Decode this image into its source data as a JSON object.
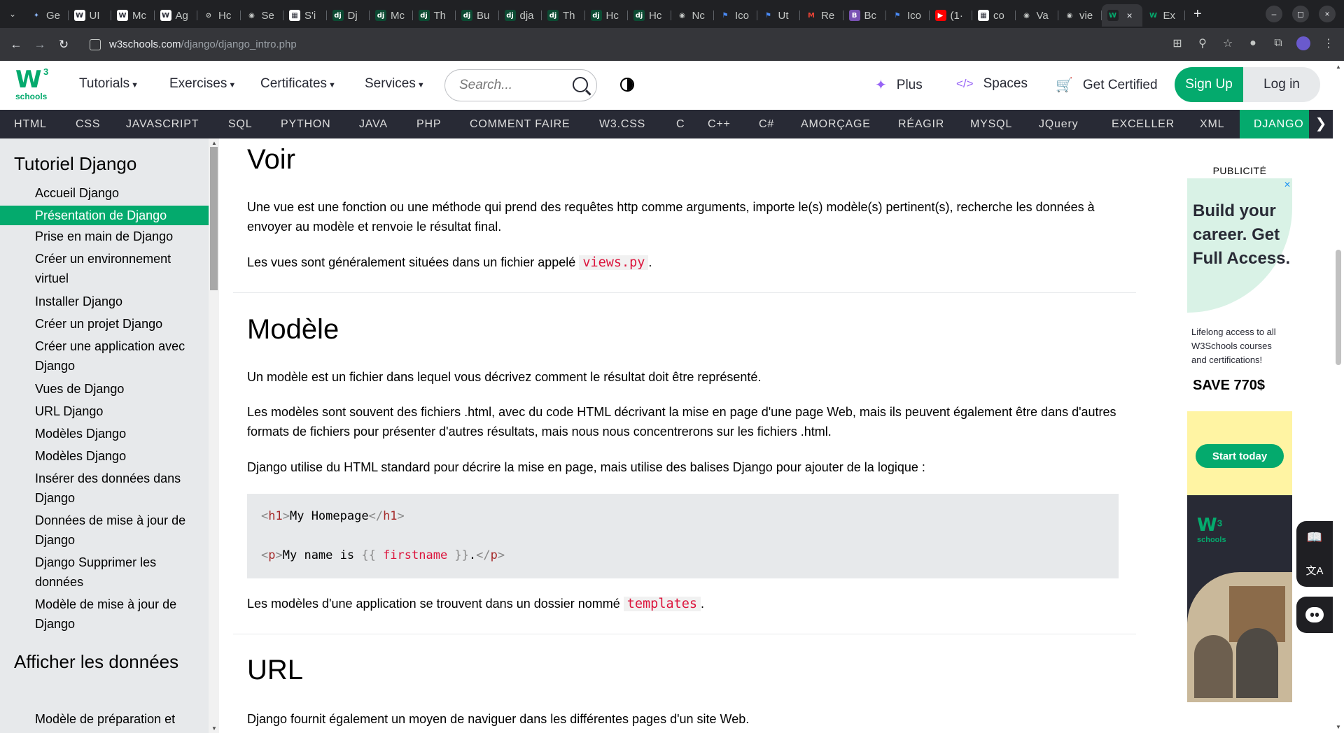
{
  "browser": {
    "tabs": [
      {
        "label": "Ge",
        "icon": "✦",
        "icon_bg": "#202124",
        "icon_fg": "#8ab4f8"
      },
      {
        "label": "UI",
        "icon": "W",
        "icon_bg": "#ffffff",
        "icon_fg": "#282a35"
      },
      {
        "label": "Mc",
        "icon": "W",
        "icon_bg": "#ffffff",
        "icon_fg": "#282a35"
      },
      {
        "label": "Ag",
        "icon": "W",
        "icon_bg": "#ffffff",
        "icon_fg": "#282a35"
      },
      {
        "label": "Hc",
        "icon": "⊘",
        "icon_bg": "#202124",
        "icon_fg": "#c4c7c5"
      },
      {
        "label": "Se",
        "icon": "◉",
        "icon_bg": "#202124",
        "icon_fg": "#c4c7c5"
      },
      {
        "label": "S'i",
        "icon": "▦",
        "icon_bg": "#ffffff",
        "icon_fg": "#282a35"
      },
      {
        "label": "Dj",
        "icon": "dj",
        "icon_bg": "#0c4b33",
        "icon_fg": "#ffffff"
      },
      {
        "label": "Mc",
        "icon": "dj",
        "icon_bg": "#0c4b33",
        "icon_fg": "#ffffff"
      },
      {
        "label": "Th",
        "icon": "dj",
        "icon_bg": "#0c4b33",
        "icon_fg": "#ffffff"
      },
      {
        "label": "Bu",
        "icon": "dj",
        "icon_bg": "#0c4b33",
        "icon_fg": "#ffffff"
      },
      {
        "label": "dja",
        "icon": "dj",
        "icon_bg": "#0c4b33",
        "icon_fg": "#ffffff"
      },
      {
        "label": "Th",
        "icon": "dj",
        "icon_bg": "#0c4b33",
        "icon_fg": "#ffffff"
      },
      {
        "label": "Hc",
        "icon": "dj",
        "icon_bg": "#0c4b33",
        "icon_fg": "#ffffff"
      },
      {
        "label": "Hc",
        "icon": "dj",
        "icon_bg": "#0c4b33",
        "icon_fg": "#ffffff"
      },
      {
        "label": "Nc",
        "icon": "◉",
        "icon_bg": "#202124",
        "icon_fg": "#c4c7c5"
      },
      {
        "label": "Ico",
        "icon": "⚑",
        "icon_bg": "#202124",
        "icon_fg": "#4a8af4"
      },
      {
        "label": "Ut",
        "icon": "⚑",
        "icon_bg": "#202124",
        "icon_fg": "#4a8af4"
      },
      {
        "label": "Re",
        "icon": "M",
        "icon_bg": "#202124",
        "icon_fg": "#ea4335"
      },
      {
        "label": "Bc",
        "icon": "B",
        "icon_bg": "#7952b3",
        "icon_fg": "#ffffff"
      },
      {
        "label": "Ico",
        "icon": "⚑",
        "icon_bg": "#202124",
        "icon_fg": "#4a8af4"
      },
      {
        "label": "(1·",
        "icon": "▶",
        "icon_bg": "#ff0000",
        "icon_fg": "#ffffff"
      },
      {
        "label": "co",
        "icon": "▦",
        "icon_bg": "#ffffff",
        "icon_fg": "#282a35"
      },
      {
        "label": "Va",
        "icon": "◉",
        "icon_bg": "#202124",
        "icon_fg": "#c4c7c5"
      },
      {
        "label": "vie",
        "icon": "◉",
        "icon_bg": "#202124",
        "icon_fg": "#c4c7c5"
      }
    ],
    "active_tab": {
      "label": "",
      "icon": "W",
      "icon_bg": "#202124",
      "icon_fg": "#04aa6d",
      "close": "×"
    },
    "last_tab": {
      "label": "Ex",
      "icon": "W",
      "icon_bg": "#202124",
      "icon_fg": "#04aa6d"
    },
    "new_tab": "+",
    "window_controls": [
      "–",
      "◻",
      "×"
    ],
    "url_host": "w3schools.com",
    "url_path": "/django/django_intro.php"
  },
  "topnav": {
    "logo_mark": "W",
    "logo_sup": "3",
    "logo_text": "schools",
    "menus": [
      {
        "label": "Tutorials",
        "caret": "▼"
      },
      {
        "label": "Exercises",
        "caret": "▼"
      },
      {
        "label": "Certificates",
        "caret": "▼"
      },
      {
        "label": "Services",
        "caret": "▼"
      }
    ],
    "search_placeholder": "Search...",
    "plus": "Plus",
    "spaces": "Spaces",
    "get_certified": "Get Certified",
    "sign_up": "Sign Up",
    "log_in": "Log in"
  },
  "subnav": {
    "items": [
      "HTML",
      "CSS",
      "JAVASCRIPT",
      "SQL",
      "PYTHON",
      "JAVA",
      "PHP",
      "COMMENT FAIRE",
      "W3.CSS",
      "C",
      "C++",
      "C#",
      "AMORÇAGE",
      "RÉAGIR",
      "MYSQL",
      "JQuery",
      "EXCELLER",
      "XML",
      "DJANGO"
    ],
    "arrow": "❯"
  },
  "sidebar": {
    "title1": "Tutoriel Django",
    "items": [
      "Accueil Django",
      "Présentation de Django",
      "Prise en main de Django",
      "Créer un environnement virtuel",
      "Installer Django",
      "Créer un projet Django",
      "Créer une application avec Django",
      "Vues de Django",
      "URL Django",
      "Modèles Django",
      "Modèles Django",
      "Insérer des données dans Django",
      "Données de mise à jour de Django",
      "Django Supprimer les données",
      "Modèle de mise à jour de Django"
    ],
    "title2": "Afficher les données",
    "item_after": "Modèle de préparation et"
  },
  "content": {
    "h_voir": "Voir",
    "p_voir1": "Une vue est une fonction ou une méthode qui prend des requêtes http comme arguments, importe le(s) modèle(s) pertinent(s), recherche les données à envoyer au modèle et renvoie le résultat final.",
    "p_voir2_before": "Les vues sont généralement situées dans un fichier appelé ",
    "p_voir2_code": "views.py",
    "p_voir2_after": ".",
    "h_modele": "Modèle",
    "p_mod1": "Un modèle est un fichier dans lequel vous décrivez comment le résultat doit être représenté.",
    "p_mod2": "Les modèles sont souvent des fichiers .html, avec du code HTML décrivant la mise en page d'une page Web, mais ils peuvent également être dans d'autres formats de fichiers pour présenter d'autres résultats, mais nous nous concentrerons sur les fichiers .html.",
    "p_mod3": "Django utilise du HTML standard pour décrire la mise en page, mais utilise des balises Django pour ajouter de la logique :",
    "code": {
      "l1_lt": "<",
      "l1_tag": "h1",
      "l1_gt": ">",
      "l1_text": "My Homepage",
      "l1_clt": "</",
      "l1_ctag": "h1",
      "l1_cgt": ">",
      "l2_lt": "<",
      "l2_tag": "p",
      "l2_gt": ">",
      "l2_text": "My name is ",
      "l2_ob": "{{",
      "l2_var": " firstname ",
      "l2_cb": "}}",
      "l2_dot": ".",
      "l2_clt": "</",
      "l2_ctag": "p",
      "l2_cgt": ">"
    },
    "p_mod4_before": "Les modèles d'une application se trouvent dans un dossier nommé ",
    "p_mod4_code": "templates",
    "p_mod4_after": ".",
    "h_url": "URL",
    "p_url1": "Django fournit également un moyen de naviguer dans les différentes pages d'un site Web."
  },
  "ad": {
    "label": "PUBLICITÉ",
    "close": "✕",
    "headline": "Build your career. Get Full Access.",
    "small": "Lifelong access to all W3Schools courses and certifications!",
    "save": "SAVE 770$",
    "cta": "Start today",
    "logo_mark": "W",
    "logo_sup": "3",
    "logo_text": "schools"
  },
  "colors": {
    "brand_green": "#04aa6d",
    "dark": "#282a35",
    "code_red": "#dc143c"
  }
}
